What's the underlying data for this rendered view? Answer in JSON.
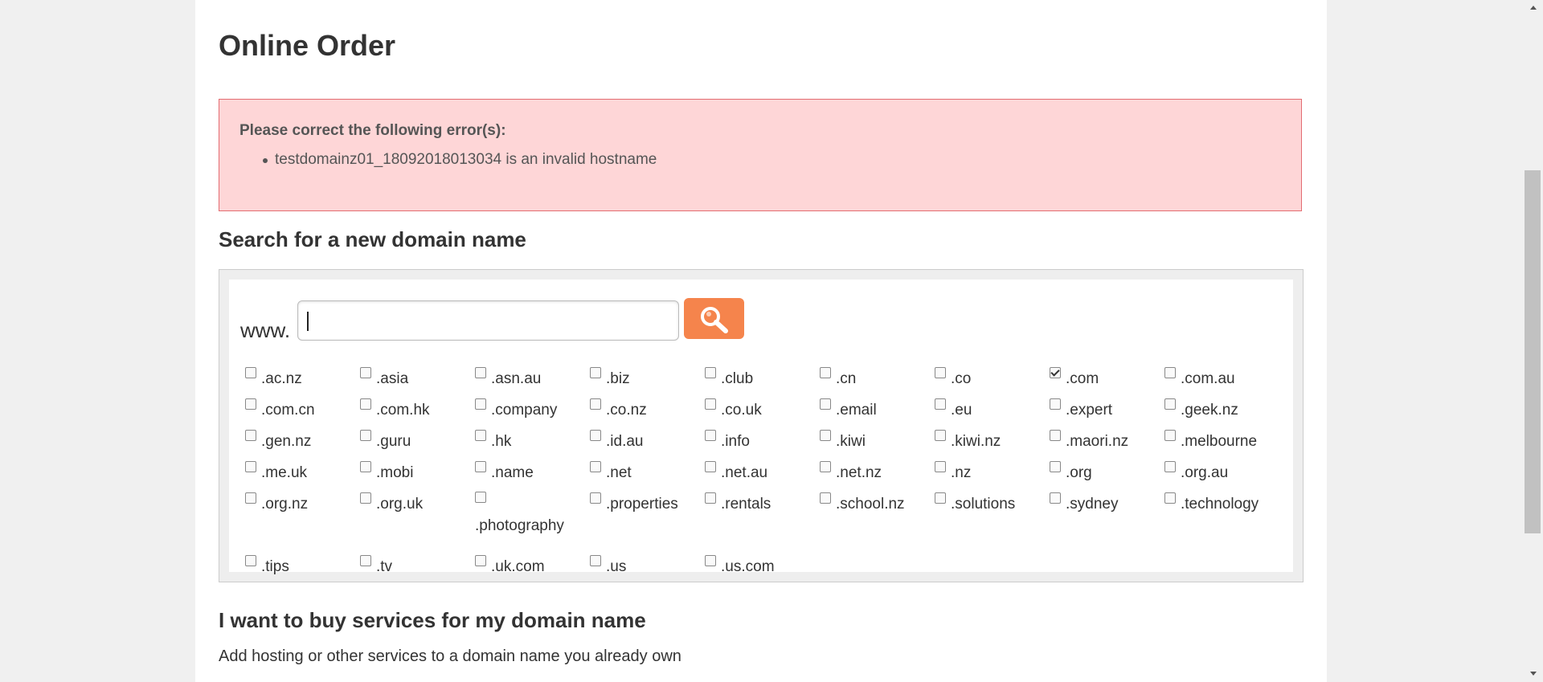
{
  "page": {
    "title": "Online Order"
  },
  "error": {
    "heading": "Please correct the following error(s):",
    "items": [
      "testdomainz01_18092018013034 is an invalid hostname"
    ]
  },
  "search": {
    "heading": "Search for a new domain name",
    "prefix": "www.",
    "input_value": "",
    "button_icon": "magnifier-icon",
    "tlds": [
      {
        "label": ".ac.nz",
        "checked": false
      },
      {
        "label": ".asia",
        "checked": false
      },
      {
        "label": ".asn.au",
        "checked": false
      },
      {
        "label": ".biz",
        "checked": false
      },
      {
        "label": ".club",
        "checked": false
      },
      {
        "label": ".cn",
        "checked": false
      },
      {
        "label": ".co",
        "checked": false
      },
      {
        "label": ".com",
        "checked": true
      },
      {
        "label": ".com.au",
        "checked": false
      },
      {
        "label": ".com.cn",
        "checked": false
      },
      {
        "label": ".com.hk",
        "checked": false
      },
      {
        "label": ".company",
        "checked": false
      },
      {
        "label": ".co.nz",
        "checked": false
      },
      {
        "label": ".co.uk",
        "checked": false
      },
      {
        "label": ".email",
        "checked": false
      },
      {
        "label": ".eu",
        "checked": false
      },
      {
        "label": ".expert",
        "checked": false
      },
      {
        "label": ".geek.nz",
        "checked": false
      },
      {
        "label": ".gen.nz",
        "checked": false
      },
      {
        "label": ".guru",
        "checked": false
      },
      {
        "label": ".hk",
        "checked": false
      },
      {
        "label": ".id.au",
        "checked": false
      },
      {
        "label": ".info",
        "checked": false
      },
      {
        "label": ".kiwi",
        "checked": false
      },
      {
        "label": ".kiwi.nz",
        "checked": false
      },
      {
        "label": ".maori.nz",
        "checked": false
      },
      {
        "label": ".melbourne",
        "checked": false
      },
      {
        "label": ".me.uk",
        "checked": false
      },
      {
        "label": ".mobi",
        "checked": false
      },
      {
        "label": ".name",
        "checked": false
      },
      {
        "label": ".net",
        "checked": false
      },
      {
        "label": ".net.au",
        "checked": false
      },
      {
        "label": ".net.nz",
        "checked": false
      },
      {
        "label": ".nz",
        "checked": false
      },
      {
        "label": ".org",
        "checked": false
      },
      {
        "label": ".org.au",
        "checked": false
      },
      {
        "label": ".org.nz",
        "checked": false
      },
      {
        "label": ".org.uk",
        "checked": false
      },
      {
        "label": ".photography",
        "checked": false
      },
      {
        "label": ".properties",
        "checked": false
      },
      {
        "label": ".rentals",
        "checked": false
      },
      {
        "label": ".school.nz",
        "checked": false
      },
      {
        "label": ".solutions",
        "checked": false
      },
      {
        "label": ".sydney",
        "checked": false
      },
      {
        "label": ".technology",
        "checked": false
      },
      {
        "label": ".tips",
        "checked": false
      },
      {
        "label": ".tv",
        "checked": false
      },
      {
        "label": ".uk.com",
        "checked": false
      },
      {
        "label": ".us",
        "checked": false
      },
      {
        "label": ".us.com",
        "checked": false
      }
    ]
  },
  "services": {
    "heading": "I want to buy services for my domain name",
    "description": "Add hosting or other services to a domain name you already own"
  },
  "colors": {
    "accent": "#f5844c",
    "error_bg": "#fed6d7",
    "error_border": "#e36d72"
  }
}
